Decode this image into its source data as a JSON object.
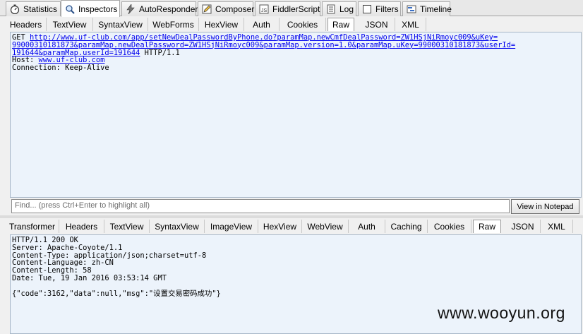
{
  "main_tabs": [
    {
      "label": "Statistics",
      "icon": "stopwatch-icon"
    },
    {
      "label": "Inspectors",
      "icon": "magnifier-icon"
    },
    {
      "label": "AutoResponder",
      "icon": "lightning-icon"
    },
    {
      "label": "Composer",
      "icon": "pencil-icon"
    },
    {
      "label": "FiddlerScript",
      "icon": "script-icon"
    },
    {
      "label": "Log",
      "icon": "log-icon"
    },
    {
      "label": "Filters",
      "icon": "checkbox-icon"
    },
    {
      "label": "Timeline",
      "icon": "timeline-icon"
    }
  ],
  "active_main_tab": "Inspectors",
  "request_tabs": [
    "Headers",
    "TextView",
    "SyntaxView",
    "WebForms",
    "HexView",
    "Auth",
    "Cookies",
    "Raw",
    "JSON",
    "XML"
  ],
  "active_request_tab": "Raw",
  "request": {
    "method": "GET ",
    "url_line1": "http://www.uf-club.com/app/setNewDealPasswordByPhone.do?paramMap.newCmfDealPassword=ZW1HSjNiRmoyc009&uKey=",
    "url_line2": "99000310181873&paramMap.newDealPassword=ZW1HSjNiRmoyc009&paramMap.version=1.0&paramMap.uKey=99000310181873&userId=",
    "url_line3": "191644&paramMap.userId=191644",
    "protocol": " HTTP/1.1",
    "host_label": "Host: ",
    "host_value": "www.uf-club.com",
    "connection_line": "Connection: Keep-Alive"
  },
  "find": {
    "placeholder": "Find... (press Ctrl+Enter to highlight all)",
    "notepad_button": "View in Notepad"
  },
  "response_tabs": [
    "Transformer",
    "Headers",
    "TextView",
    "SyntaxView",
    "ImageView",
    "HexView",
    "WebView",
    "Auth",
    "Caching",
    "Cookies",
    "Raw",
    "JSON",
    "XML"
  ],
  "active_response_tab": "Raw",
  "response": {
    "lines": [
      "HTTP/1.1 200 OK",
      "Server: Apache-Coyote/1.1",
      "Content-Type: application/json;charset=utf-8",
      "Content-Language: zh-CN",
      "Content-Length: 58",
      "Date: Tue, 19 Jan 2016 03:53:14 GMT"
    ],
    "body": "{\"code\":3162,\"data\":null,\"msg\":\"设置交易密码成功\"}"
  },
  "watermark": "www.wooyun.org"
}
